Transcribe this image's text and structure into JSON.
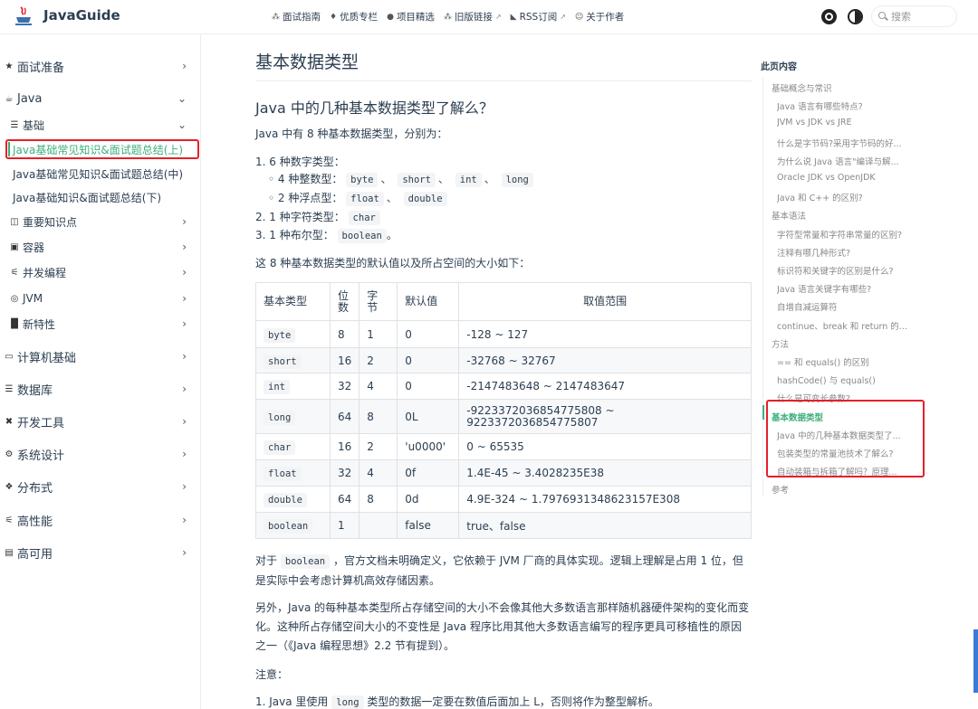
{
  "header": {
    "site_title": "JavaGuide",
    "nav": [
      {
        "icon": "book-icon",
        "label": "面试指南",
        "external": false
      },
      {
        "icon": "fire-icon",
        "label": "优质专栏",
        "external": false
      },
      {
        "icon": "github-icon",
        "label": "项目精选",
        "external": false
      },
      {
        "icon": "book-icon",
        "label": "旧版链接",
        "external": true
      },
      {
        "icon": "rss-icon",
        "label": "RSS订阅",
        "external": true
      },
      {
        "icon": "person-icon",
        "label": "关于作者",
        "external": false
      }
    ],
    "search_placeholder": "搜索"
  },
  "sidebar": {
    "items": [
      {
        "level": "top",
        "icon": "★",
        "label": "面试准备",
        "chevron": "›"
      },
      {
        "level": "top",
        "icon": "☕",
        "label": "Java",
        "chevron": "⌄"
      },
      {
        "level": "sub",
        "icon": "☰",
        "label": "基础",
        "chevron": "⌄"
      },
      {
        "level": "leaf",
        "label": "Java基础常见知识&面试题总结(上)",
        "active": true
      },
      {
        "level": "leaf",
        "label": "Java基础常见知识&面试题总结(中)"
      },
      {
        "level": "leaf",
        "label": "Java基础知识&面试题总结(下)"
      },
      {
        "level": "sub",
        "icon": "◫",
        "label": "重要知识点",
        "chevron": "›"
      },
      {
        "level": "sub",
        "icon": "▣",
        "label": "容器",
        "chevron": "›"
      },
      {
        "level": "sub",
        "icon": "⚟",
        "label": "并发编程",
        "chevron": "›"
      },
      {
        "level": "sub",
        "icon": "◎",
        "label": "JVM",
        "chevron": "›"
      },
      {
        "level": "sub",
        "icon": "█",
        "label": "新特性",
        "chevron": "›"
      },
      {
        "level": "top",
        "icon": "▭",
        "label": "计算机基础",
        "chevron": "›"
      },
      {
        "level": "top",
        "icon": "☰",
        "label": "数据库",
        "chevron": "›"
      },
      {
        "level": "top",
        "icon": "✖",
        "label": "开发工具",
        "chevron": "›"
      },
      {
        "level": "top",
        "icon": "⚙",
        "label": "系统设计",
        "chevron": "›"
      },
      {
        "level": "top",
        "icon": "❖",
        "label": "分布式",
        "chevron": "›"
      },
      {
        "level": "top",
        "icon": "⚟",
        "label": "高性能",
        "chevron": "›"
      },
      {
        "level": "top",
        "icon": "▤",
        "label": "高可用",
        "chevron": "›"
      }
    ]
  },
  "main": {
    "page_title": "基本数据类型",
    "section_title": "Java 中的几种基本数据类型了解么？",
    "intro": "Java 中有 8 种基本数据类型，分别为：",
    "list": {
      "l1": "1. 6 种数字类型：",
      "l1a_prefix": "◦ 4 种整数型：",
      "l1a_codes": [
        "byte",
        "short",
        "int",
        "long"
      ],
      "l1b_prefix": "◦ 2 种浮点型：",
      "l1b_codes": [
        "float",
        "double"
      ],
      "l2_prefix": "2. 1 种字符类型：",
      "l2_code": "char",
      "l3_prefix": "3. 1 种布尔型：",
      "l3_code": "boolean",
      "l3_suffix": "。",
      "sep": "、"
    },
    "table_intro": "这 8 种基本数据类型的默认值以及所占空间的大小如下：",
    "table": {
      "headers": [
        "基本类型",
        "位\n数",
        "字\n节",
        "默认值",
        "取值范围"
      ],
      "rows": [
        [
          "byte",
          "8",
          "1",
          "0",
          "-128 ~ 127"
        ],
        [
          "short",
          "16",
          "2",
          "0",
          "-32768 ~ 32767"
        ],
        [
          "int",
          "32",
          "4",
          "0",
          "-2147483648 ~ 2147483647"
        ],
        [
          "long",
          "64",
          "8",
          "0L",
          "-9223372036854775808 ~\n9223372036854775807"
        ],
        [
          "char",
          "16",
          "2",
          "'u0000'",
          "0 ~ 65535"
        ],
        [
          "float",
          "32",
          "4",
          "0f",
          "1.4E-45 ~ 3.4028235E38"
        ],
        [
          "double",
          "64",
          "8",
          "0d",
          "4.9E-324 ~ 1.7976931348623157E308"
        ],
        [
          "boolean",
          "1",
          "",
          "false",
          "true、false"
        ]
      ]
    },
    "p1_prefix": "对于",
    "p1_code": "boolean",
    "p1_suffix": "，官方文档未明确定义，它依赖于 JVM 厂商的具体实现。逻辑上理解是占用 1 位，但是实际中会考虑计算机高效存储因素。",
    "p2": "另外，Java 的每种基本类型所占存储空间的大小不会像其他大多数语言那样随机器硬件架构的变化而变化。这种所占存储空间大小的不变性是 Java 程序比用其他大多数语言编写的程序更具可移植性的原因之一（《Java 编程思想》2.2 节有提到）。",
    "note_label": "注意：",
    "note1_prefix": "1. Java 里使用",
    "note1_code": "long",
    "note1_suffix": "类型的数据一定要在数值后面加上 L，否则将作为整型解析。"
  },
  "toc": {
    "title": "此页内容",
    "items": [
      {
        "level": 2,
        "label": "基础概念与常识"
      },
      {
        "level": 3,
        "label": "Java 语言有哪些特点?"
      },
      {
        "level": 3,
        "label": "JVM vs JDK vs JRE"
      },
      {
        "level": 3,
        "label": "什么是字节码?采用字节码的好..."
      },
      {
        "level": 3,
        "label": "为什么说 Java 语言\"编译与解..."
      },
      {
        "level": 3,
        "label": "Oracle JDK vs OpenJDK"
      },
      {
        "level": 3,
        "label": "Java 和 C++ 的区别?"
      },
      {
        "level": 2,
        "label": "基本语法"
      },
      {
        "level": 3,
        "label": "字符型常量和字符串常量的区别?"
      },
      {
        "level": 3,
        "label": "注释有哪几种形式?"
      },
      {
        "level": 3,
        "label": "标识符和关键字的区别是什么?"
      },
      {
        "level": 3,
        "label": "Java 语言关键字有哪些?"
      },
      {
        "level": 3,
        "label": "自增自减运算符"
      },
      {
        "level": 3,
        "label": "continue、break 和 return 的..."
      },
      {
        "level": 2,
        "label": "方法"
      },
      {
        "level": 3,
        "label": "== 和 equals() 的区别"
      },
      {
        "level": 3,
        "label": "hashCode() 与 equals()"
      },
      {
        "level": 3,
        "label": "什么是可变长参数?"
      },
      {
        "level": 2,
        "label": "基本数据类型",
        "active": true
      },
      {
        "level": 3,
        "label": "Java 中的几种基本数据类型了..."
      },
      {
        "level": 3,
        "label": "包装类型的常量池技术了解么?"
      },
      {
        "level": 3,
        "label": "自动装箱与拆箱了解吗？原理..."
      },
      {
        "level": 2,
        "label": "参考"
      }
    ]
  },
  "colors": {
    "accent": "#3eaf7c",
    "highlight_box": "#e5202a",
    "text": "#2c3e50"
  }
}
